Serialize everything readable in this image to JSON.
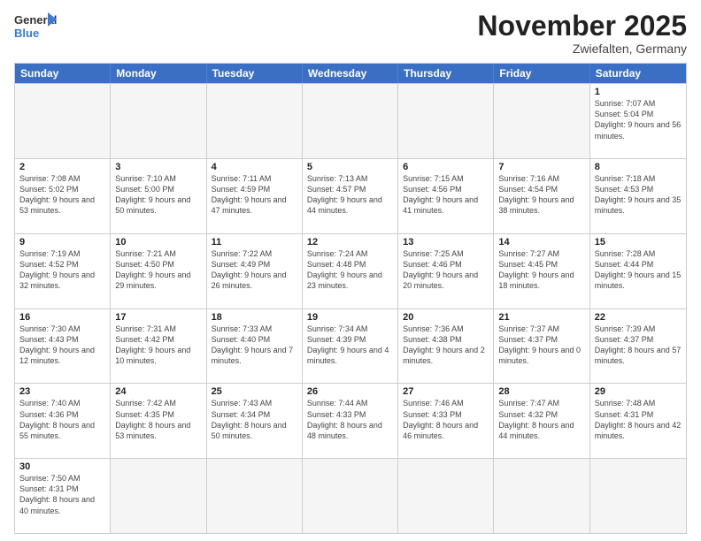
{
  "logo": {
    "line1": "General",
    "line2": "Blue"
  },
  "title": "November 2025",
  "subtitle": "Zwiefalten, Germany",
  "header_days": [
    "Sunday",
    "Monday",
    "Tuesday",
    "Wednesday",
    "Thursday",
    "Friday",
    "Saturday"
  ],
  "rows": [
    [
      {
        "date": "",
        "info": "",
        "empty": true
      },
      {
        "date": "",
        "info": "",
        "empty": true
      },
      {
        "date": "",
        "info": "",
        "empty": true
      },
      {
        "date": "",
        "info": "",
        "empty": true
      },
      {
        "date": "",
        "info": "",
        "empty": true
      },
      {
        "date": "",
        "info": "",
        "empty": true
      },
      {
        "date": "1",
        "info": "Sunrise: 7:07 AM\nSunset: 5:04 PM\nDaylight: 9 hours and 56 minutes.",
        "empty": false
      }
    ],
    [
      {
        "date": "2",
        "info": "Sunrise: 7:08 AM\nSunset: 5:02 PM\nDaylight: 9 hours and 53 minutes.",
        "empty": false
      },
      {
        "date": "3",
        "info": "Sunrise: 7:10 AM\nSunset: 5:00 PM\nDaylight: 9 hours and 50 minutes.",
        "empty": false
      },
      {
        "date": "4",
        "info": "Sunrise: 7:11 AM\nSunset: 4:59 PM\nDaylight: 9 hours and 47 minutes.",
        "empty": false
      },
      {
        "date": "5",
        "info": "Sunrise: 7:13 AM\nSunset: 4:57 PM\nDaylight: 9 hours and 44 minutes.",
        "empty": false
      },
      {
        "date": "6",
        "info": "Sunrise: 7:15 AM\nSunset: 4:56 PM\nDaylight: 9 hours and 41 minutes.",
        "empty": false
      },
      {
        "date": "7",
        "info": "Sunrise: 7:16 AM\nSunset: 4:54 PM\nDaylight: 9 hours and 38 minutes.",
        "empty": false
      },
      {
        "date": "8",
        "info": "Sunrise: 7:18 AM\nSunset: 4:53 PM\nDaylight: 9 hours and 35 minutes.",
        "empty": false
      }
    ],
    [
      {
        "date": "9",
        "info": "Sunrise: 7:19 AM\nSunset: 4:52 PM\nDaylight: 9 hours and 32 minutes.",
        "empty": false
      },
      {
        "date": "10",
        "info": "Sunrise: 7:21 AM\nSunset: 4:50 PM\nDaylight: 9 hours and 29 minutes.",
        "empty": false
      },
      {
        "date": "11",
        "info": "Sunrise: 7:22 AM\nSunset: 4:49 PM\nDaylight: 9 hours and 26 minutes.",
        "empty": false
      },
      {
        "date": "12",
        "info": "Sunrise: 7:24 AM\nSunset: 4:48 PM\nDaylight: 9 hours and 23 minutes.",
        "empty": false
      },
      {
        "date": "13",
        "info": "Sunrise: 7:25 AM\nSunset: 4:46 PM\nDaylight: 9 hours and 20 minutes.",
        "empty": false
      },
      {
        "date": "14",
        "info": "Sunrise: 7:27 AM\nSunset: 4:45 PM\nDaylight: 9 hours and 18 minutes.",
        "empty": false
      },
      {
        "date": "15",
        "info": "Sunrise: 7:28 AM\nSunset: 4:44 PM\nDaylight: 9 hours and 15 minutes.",
        "empty": false
      }
    ],
    [
      {
        "date": "16",
        "info": "Sunrise: 7:30 AM\nSunset: 4:43 PM\nDaylight: 9 hours and 12 minutes.",
        "empty": false
      },
      {
        "date": "17",
        "info": "Sunrise: 7:31 AM\nSunset: 4:42 PM\nDaylight: 9 hours and 10 minutes.",
        "empty": false
      },
      {
        "date": "18",
        "info": "Sunrise: 7:33 AM\nSunset: 4:40 PM\nDaylight: 9 hours and 7 minutes.",
        "empty": false
      },
      {
        "date": "19",
        "info": "Sunrise: 7:34 AM\nSunset: 4:39 PM\nDaylight: 9 hours and 4 minutes.",
        "empty": false
      },
      {
        "date": "20",
        "info": "Sunrise: 7:36 AM\nSunset: 4:38 PM\nDaylight: 9 hours and 2 minutes.",
        "empty": false
      },
      {
        "date": "21",
        "info": "Sunrise: 7:37 AM\nSunset: 4:37 PM\nDaylight: 9 hours and 0 minutes.",
        "empty": false
      },
      {
        "date": "22",
        "info": "Sunrise: 7:39 AM\nSunset: 4:37 PM\nDaylight: 8 hours and 57 minutes.",
        "empty": false
      }
    ],
    [
      {
        "date": "23",
        "info": "Sunrise: 7:40 AM\nSunset: 4:36 PM\nDaylight: 8 hours and 55 minutes.",
        "empty": false
      },
      {
        "date": "24",
        "info": "Sunrise: 7:42 AM\nSunset: 4:35 PM\nDaylight: 8 hours and 53 minutes.",
        "empty": false
      },
      {
        "date": "25",
        "info": "Sunrise: 7:43 AM\nSunset: 4:34 PM\nDaylight: 8 hours and 50 minutes.",
        "empty": false
      },
      {
        "date": "26",
        "info": "Sunrise: 7:44 AM\nSunset: 4:33 PM\nDaylight: 8 hours and 48 minutes.",
        "empty": false
      },
      {
        "date": "27",
        "info": "Sunrise: 7:46 AM\nSunset: 4:33 PM\nDaylight: 8 hours and 46 minutes.",
        "empty": false
      },
      {
        "date": "28",
        "info": "Sunrise: 7:47 AM\nSunset: 4:32 PM\nDaylight: 8 hours and 44 minutes.",
        "empty": false
      },
      {
        "date": "29",
        "info": "Sunrise: 7:48 AM\nSunset: 4:31 PM\nDaylight: 8 hours and 42 minutes.",
        "empty": false
      }
    ],
    [
      {
        "date": "30",
        "info": "Sunrise: 7:50 AM\nSunset: 4:31 PM\nDaylight: 8 hours and 40 minutes.",
        "empty": false
      },
      {
        "date": "",
        "info": "",
        "empty": true
      },
      {
        "date": "",
        "info": "",
        "empty": true
      },
      {
        "date": "",
        "info": "",
        "empty": true
      },
      {
        "date": "",
        "info": "",
        "empty": true
      },
      {
        "date": "",
        "info": "",
        "empty": true
      },
      {
        "date": "",
        "info": "",
        "empty": true
      }
    ]
  ]
}
